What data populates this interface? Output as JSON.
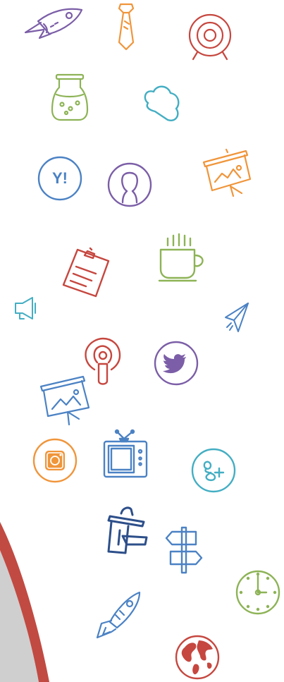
{
  "colors": {
    "purple": "#7b5ea7",
    "orange": "#f0953a",
    "red": "#c6473f",
    "green": "#8db356",
    "teal": "#43aec3",
    "blue": "#4b82c4",
    "navy": "#2d4f8a",
    "swoosh_red": "#c14a42",
    "swoosh_gray": "#cfcfcf"
  },
  "icons": [
    {
      "name": "rocket-icon",
      "color": "purple"
    },
    {
      "name": "necktie-icon",
      "color": "orange"
    },
    {
      "name": "target-icon",
      "color": "red"
    },
    {
      "name": "potion-jar-icon",
      "color": "green"
    },
    {
      "name": "cloud-icon",
      "color": "teal"
    },
    {
      "name": "yahoo-icon",
      "color": "blue",
      "text": "Y!"
    },
    {
      "name": "user-avatar-icon",
      "color": "purple"
    },
    {
      "name": "presentation-board-icon",
      "color": "orange"
    },
    {
      "name": "clipboard-icon",
      "color": "red"
    },
    {
      "name": "coffee-cup-icon",
      "color": "green"
    },
    {
      "name": "megaphone-icon",
      "color": "teal"
    },
    {
      "name": "paper-plane-icon",
      "color": "blue"
    },
    {
      "name": "podcast-icon",
      "color": "red"
    },
    {
      "name": "twitter-icon",
      "color": "purple"
    },
    {
      "name": "presentation-board-icon",
      "color": "blue"
    },
    {
      "name": "instagram-icon",
      "color": "orange"
    },
    {
      "name": "television-icon",
      "color": "blue"
    },
    {
      "name": "google-plus-icon",
      "color": "teal"
    },
    {
      "name": "trash-bin-icon",
      "color": "navy"
    },
    {
      "name": "signpost-icon",
      "color": "blue"
    },
    {
      "name": "clock-icon",
      "color": "green"
    },
    {
      "name": "rocket-icon",
      "color": "blue"
    },
    {
      "name": "globe-icon",
      "color": "red"
    }
  ]
}
